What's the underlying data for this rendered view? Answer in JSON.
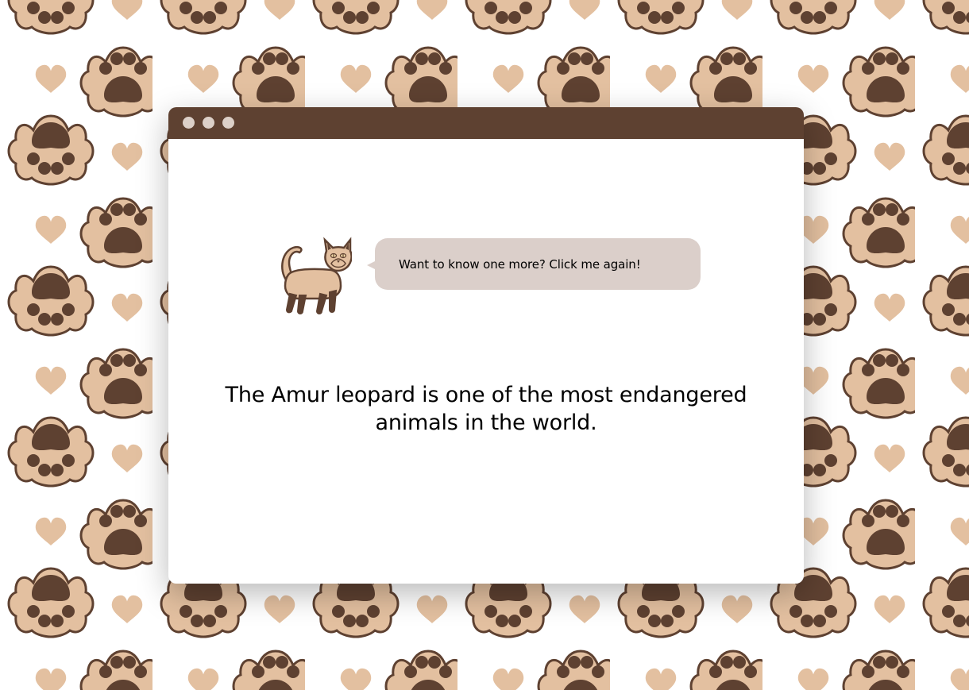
{
  "background": {
    "pattern": "paw-prints-and-hearts",
    "colors": {
      "paw_outline": "#5e4131",
      "paw_fill": "#e3c0a0",
      "heart": "#e3c0a0"
    }
  },
  "window": {
    "titlebar_color": "#5e4131",
    "dot_color": "#dcd0c8"
  },
  "cat": {
    "icon": "cat-icon",
    "body_color": "#e3c0a0",
    "points_color": "#5e4131"
  },
  "bubble": {
    "text": "Want to know one more? Click me again!",
    "color": "#dbcfca"
  },
  "fact": {
    "text": "The Amur leopard is one of the most endangered animals in the world."
  }
}
